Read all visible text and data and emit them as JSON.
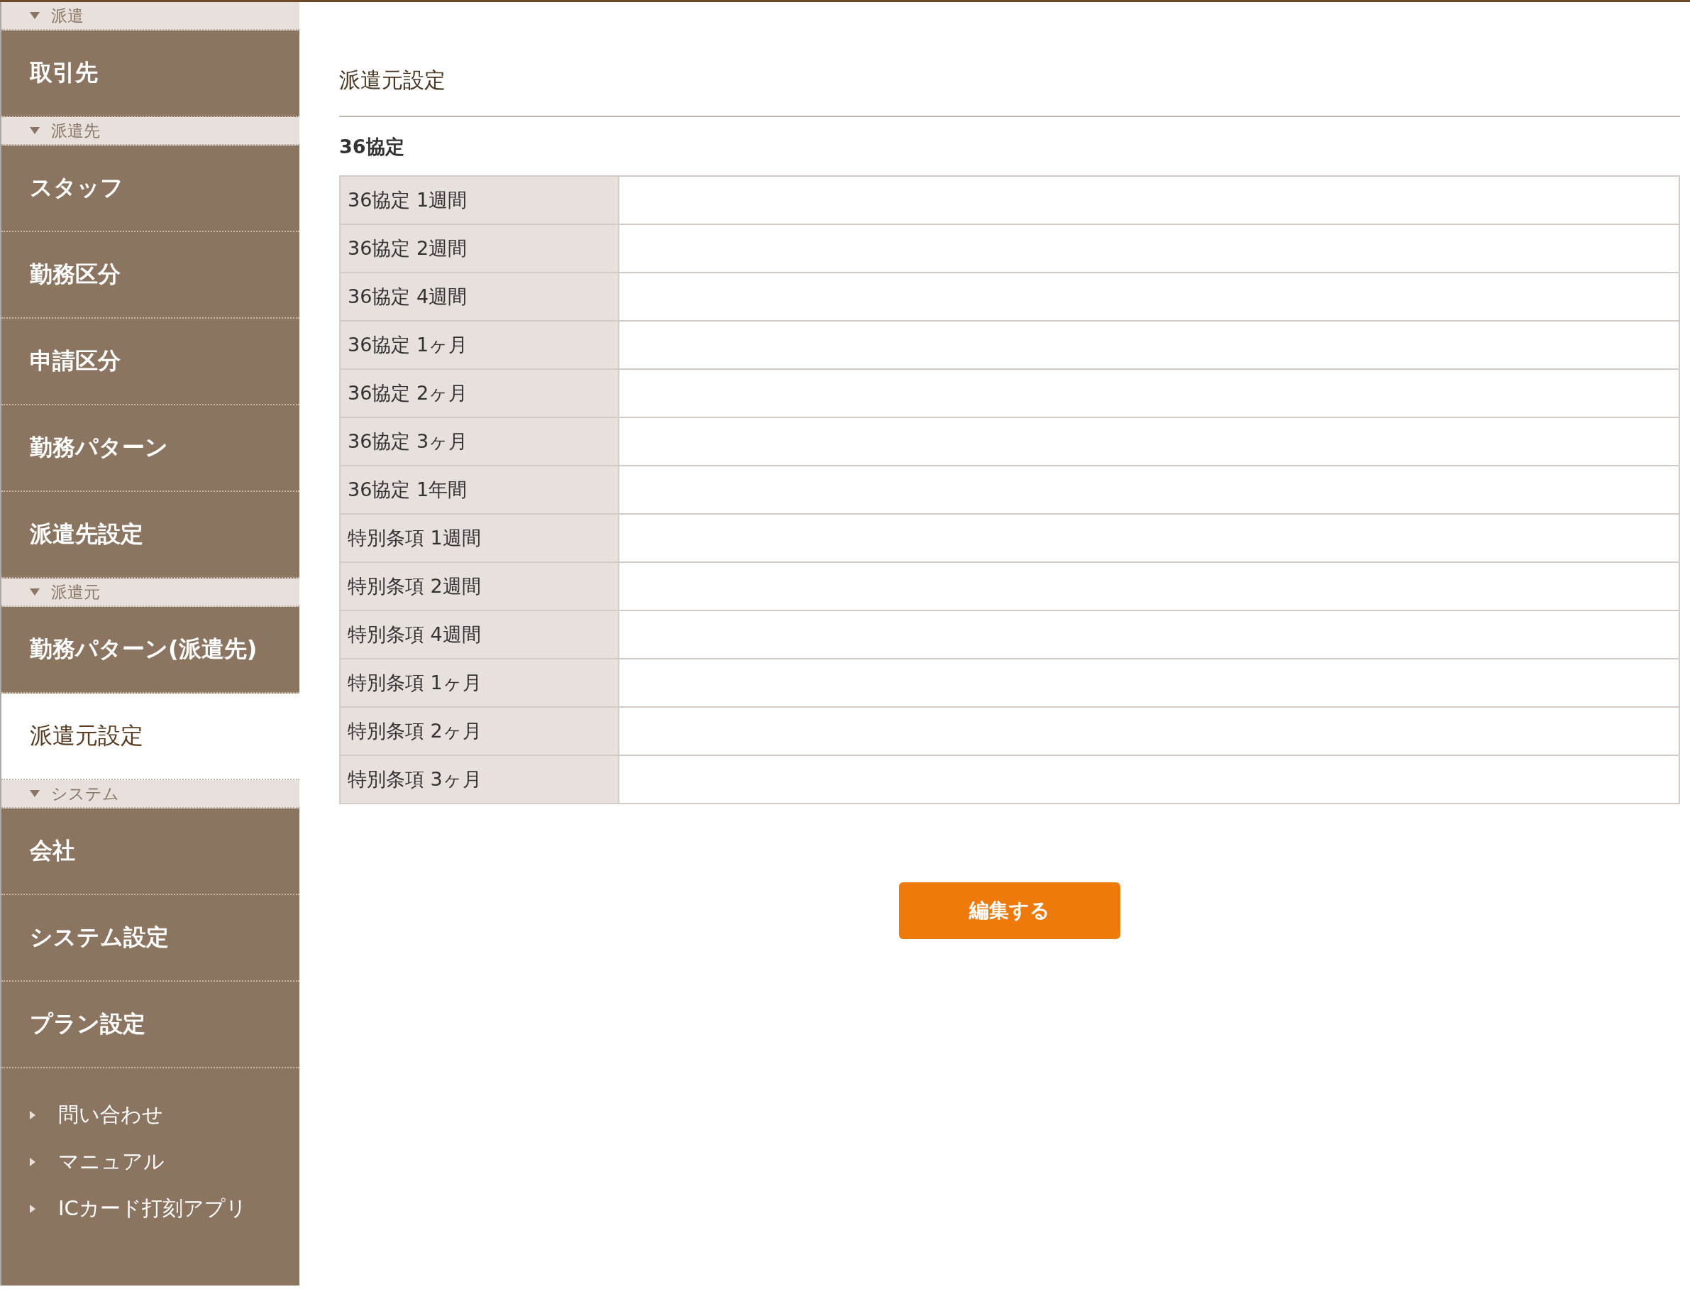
{
  "sidebar": {
    "sections": [
      {
        "header": "派遣",
        "expanded": true,
        "items": [
          {
            "label": "取引先",
            "selected": false
          }
        ]
      },
      {
        "header": "派遣先",
        "expanded": true,
        "items": [
          {
            "label": "スタッフ",
            "selected": false
          },
          {
            "label": "勤務区分",
            "selected": false
          },
          {
            "label": "申請区分",
            "selected": false
          },
          {
            "label": "勤務パターン",
            "selected": false
          },
          {
            "label": "派遣先設定",
            "selected": false
          }
        ]
      },
      {
        "header": "派遣元",
        "expanded": true,
        "items": [
          {
            "label": "勤務パターン(派遣先)",
            "selected": false
          },
          {
            "label": "派遣元設定",
            "selected": true
          }
        ]
      },
      {
        "header": "システム",
        "expanded": true,
        "items": [
          {
            "label": "会社",
            "selected": false
          },
          {
            "label": "システム設定",
            "selected": false
          },
          {
            "label": "プラン設定",
            "selected": false
          }
        ]
      }
    ],
    "links": [
      "問い合わせ",
      "マニュアル",
      "ICカード打刻アプリ"
    ]
  },
  "page_title": "派遣元設定",
  "section_title": "36協定",
  "table": {
    "rows": [
      {
        "label": "36協定 1週間"
      },
      {
        "label": "36協定 2週間"
      },
      {
        "label": "36協定 4週間"
      },
      {
        "label": "36協定 1ヶ月"
      },
      {
        "label": "36協定 2ヶ月"
      },
      {
        "label": "36協定 3ヶ月"
      },
      {
        "label": "36協定 1年間"
      },
      {
        "label": "特別条項 1週間"
      },
      {
        "label": "特別条項 2週間"
      },
      {
        "label": "特別条項 4週間"
      },
      {
        "label": "特別条項 1ヶ月"
      },
      {
        "label": "特別条項 2ヶ月"
      },
      {
        "label": "特別条項 3ヶ月"
      }
    ]
  },
  "edit_button": "編集する"
}
